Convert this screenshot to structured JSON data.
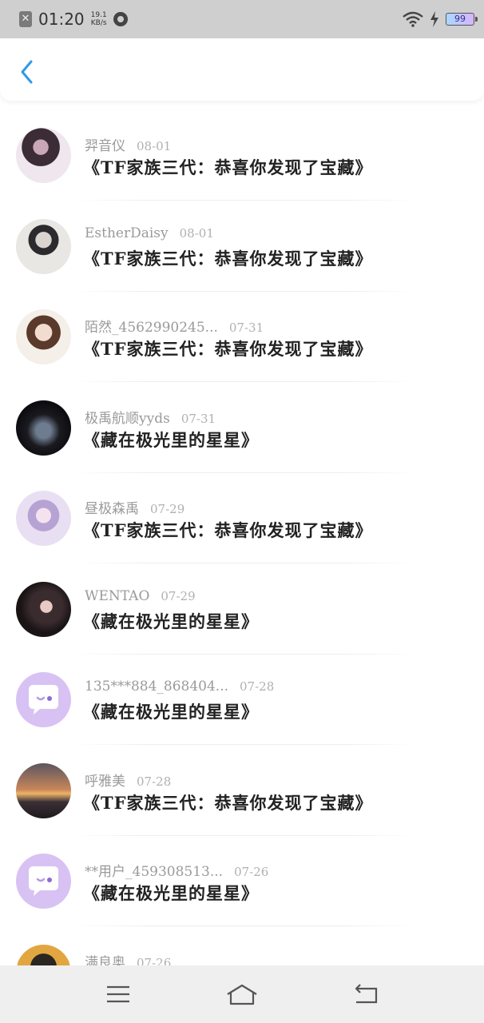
{
  "status_bar": {
    "time": "01:20",
    "speed_value": "19.1",
    "speed_unit": "KB/s",
    "battery": "99",
    "notif_icon": "close-box-icon",
    "app_icon": "app-notification-icon",
    "wifi_icon": "wifi-icon",
    "charging_icon": "lightning-icon"
  },
  "header": {
    "back_icon": "chevron-left-icon",
    "accent": "#2e9ae6"
  },
  "items": [
    {
      "user": "羿音仪",
      "date": "08-01",
      "title": "《TF家族三代：恭喜你发现了宝藏》",
      "avatar": "photo"
    },
    {
      "user": "EstherDaisy",
      "date": "08-01",
      "title": "《TF家族三代：恭喜你发现了宝藏》",
      "avatar": "photo"
    },
    {
      "user": "陌然_4562990245...",
      "date": "07-31",
      "title": "《TF家族三代：恭喜你发现了宝藏》",
      "avatar": "photo"
    },
    {
      "user": "极禹航顺yyds",
      "date": "07-31",
      "title": "《藏在极光里的星星》",
      "avatar": "photo"
    },
    {
      "user": "昼极森禹",
      "date": "07-29",
      "title": "《TF家族三代：恭喜你发现了宝藏》",
      "avatar": "photo"
    },
    {
      "user": "WENTAO",
      "date": "07-29",
      "title": "《藏在极光里的星星》",
      "avatar": "photo"
    },
    {
      "user": "135***884_868404...",
      "date": "07-28",
      "title": "《藏在极光里的星星》",
      "avatar": "default-chat-avatar-icon"
    },
    {
      "user": "呼雅美",
      "date": "07-28",
      "title": "《TF家族三代：恭喜你发现了宝藏》",
      "avatar": "photo"
    },
    {
      "user": "**用户_459308513...",
      "date": "07-26",
      "title": "《藏在极光里的星星》",
      "avatar": "default-chat-avatar-icon"
    },
    {
      "user": "满良奥",
      "date": "07-26",
      "title": "",
      "avatar": "photo"
    }
  ],
  "nav": {
    "menu_icon": "menu-icon",
    "home_icon": "home-icon",
    "back_icon": "back-arrow-icon"
  }
}
